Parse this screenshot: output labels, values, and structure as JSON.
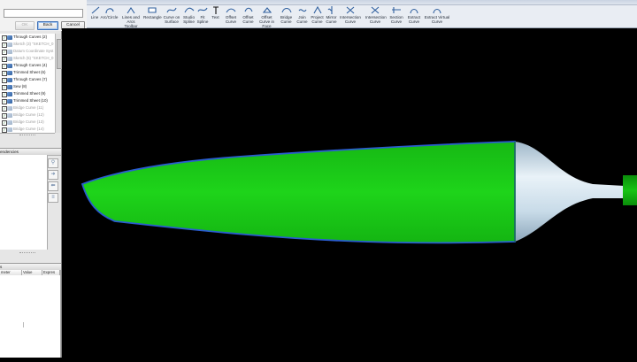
{
  "dialog": {
    "ok_label": "OK",
    "back_label": "Back",
    "cancel_label": "Cancel"
  },
  "ribbon": {
    "tools": [
      {
        "label": "Line",
        "icon": "line-icon"
      },
      {
        "label": "Arc/Circle",
        "icon": "arc-circle-icon"
      },
      {
        "label": "Lines and Arcs Toolbar",
        "icon": "lines-arcs-toolbar-icon"
      },
      {
        "label": "Rectangle",
        "icon": "rectangle-icon"
      },
      {
        "label": "Curve on Surface",
        "icon": "curve-on-surface-icon"
      },
      {
        "label": "Studio Spline",
        "icon": "studio-spline-icon"
      },
      {
        "label": "Fit Spline",
        "icon": "fit-spline-icon"
      },
      {
        "label": "Text",
        "icon": "text-icon"
      },
      {
        "label": "Offset Curve",
        "icon": "offset-curve-icon"
      },
      {
        "label": "Offset Curve",
        "icon": "offset-curve-icon"
      },
      {
        "label": "Offset Curve in Face",
        "icon": "offset-curve-in-face-icon"
      },
      {
        "label": "Bridge Curve",
        "icon": "bridge-curve-icon"
      },
      {
        "label": "Join Curve",
        "icon": "join-curve-icon"
      },
      {
        "label": "Project Curve",
        "icon": "project-curve-icon"
      },
      {
        "label": "Mirror Curve",
        "icon": "mirror-curve-icon"
      },
      {
        "label": "Intersection Curve",
        "icon": "intersection-curve-icon"
      },
      {
        "label": "Intersection Curve",
        "icon": "intersection-curve-icon"
      },
      {
        "label": "Section Curve",
        "icon": "section-curve-icon"
      },
      {
        "label": "Extract Curve",
        "icon": "extract-curve-icon"
      },
      {
        "label": "Extract Virtual Curve",
        "icon": "extract-virtual-curve-icon"
      }
    ]
  },
  "tree": {
    "items": [
      {
        "label": "Through Curves (2)",
        "dim": false
      },
      {
        "label": "Sketch (3) \"SKETCH_0",
        "dim": true
      },
      {
        "label": "Datum Coordinate Syst",
        "dim": true
      },
      {
        "label": "Sketch (5) \"SKETCH_0",
        "dim": true
      },
      {
        "label": "Through Curves (4)",
        "dim": false
      },
      {
        "label": "Trimmed Sheet (6)",
        "dim": false
      },
      {
        "label": "Through Curves (7)",
        "dim": false
      },
      {
        "label": "Sew (8)",
        "dim": false
      },
      {
        "label": "Trimmed Sheet (9)",
        "dim": false
      },
      {
        "label": "Trimmed Sheet (10)",
        "dim": false
      },
      {
        "label": "Bridge Curve (11)",
        "dim": true
      },
      {
        "label": "Bridge Curve (12)",
        "dim": true
      },
      {
        "label": "Bridge Curve (13)",
        "dim": true
      },
      {
        "label": "Bridge Curve (14)",
        "dim": true
      },
      {
        "label": "Bridge Curve (15)",
        "dim": true
      }
    ]
  },
  "panels": {
    "dependencies_title": "endencies",
    "details_title": "s",
    "details_columns": [
      "meter",
      "Value",
      "Expres"
    ]
  },
  "colors": {
    "part_green": "#18c414",
    "part_edge": "#2a5ccf",
    "shaft_light": "#dde9f2",
    "hub_green": "#0fa20f",
    "viewport_bg": "#000000"
  }
}
